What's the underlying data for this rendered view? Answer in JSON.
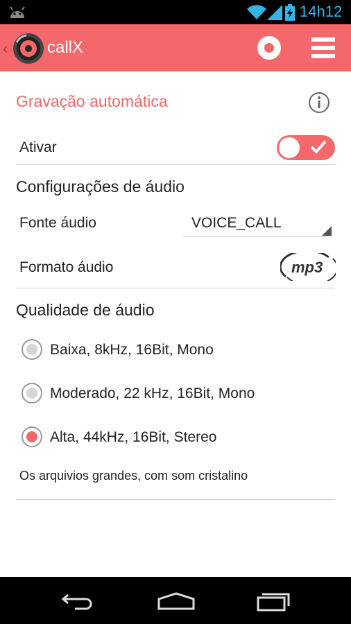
{
  "status_bar": {
    "time": "14h12",
    "icons": [
      "android-icon",
      "wifi-icon",
      "signal-icon",
      "battery-charging-icon"
    ]
  },
  "app_bar": {
    "title": "callX",
    "icons": [
      "back-icon",
      "app-logo-icon",
      "record-icon",
      "menu-icon"
    ]
  },
  "auto_record": {
    "title": "Gravação automática",
    "enable_label": "Ativar",
    "enabled": true
  },
  "audio_settings": {
    "title": "Configurações de áudio",
    "source_label": "Fonte áudio",
    "source_value": "VOICE_CALL",
    "format_label": "Formato áudio",
    "format_logo": "mp3"
  },
  "audio_quality": {
    "title": "Qualidade de áudio",
    "options": [
      {
        "label": "Baixa, 8kHz, 16Bit, Mono",
        "checked": false
      },
      {
        "label": "Moderado, 22 kHz, 16Bit, Mono",
        "checked": false
      },
      {
        "label": "Alta, 44kHz, 16Bit, Stereo",
        "checked": true
      }
    ],
    "note": "Os arquivios grandes, com som cristalino"
  },
  "colors": {
    "accent": "#f4676a",
    "status_blue": "#33b5e5"
  }
}
